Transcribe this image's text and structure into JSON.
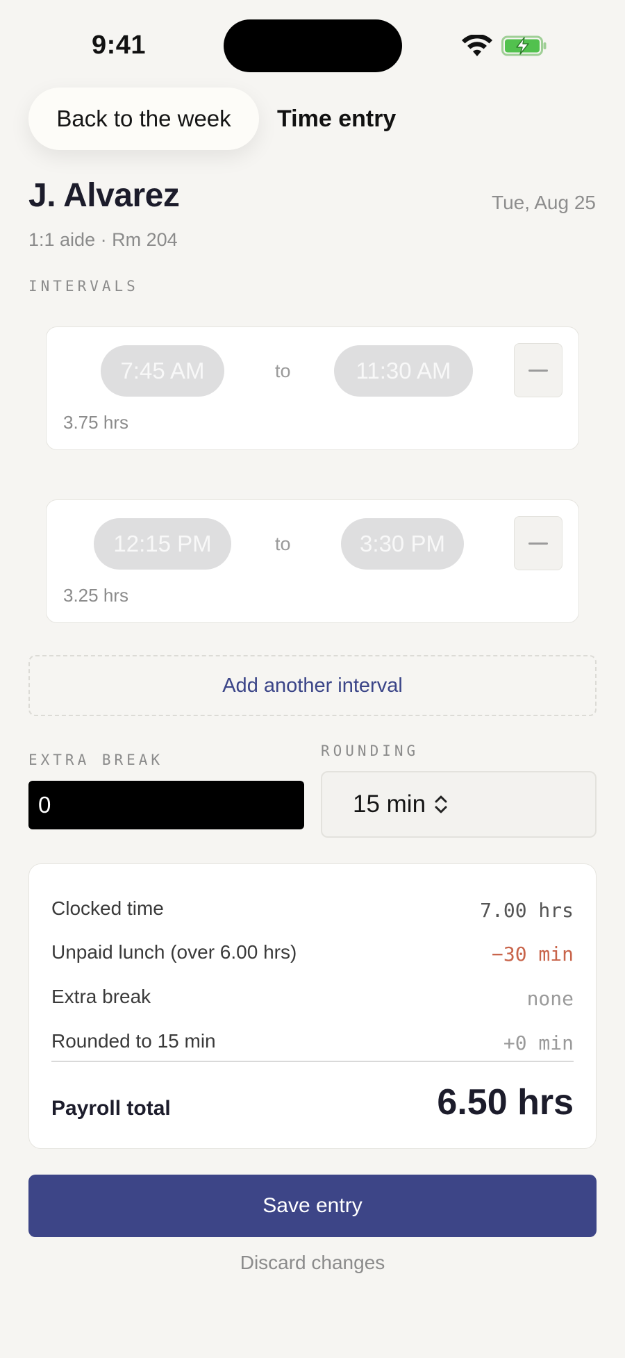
{
  "status_bar": {
    "time": "9:41"
  },
  "nav": {
    "back_label": "Back to the week",
    "title": "Time entry"
  },
  "employee": {
    "name": "J. Alvarez",
    "date": "Tue, Aug 25",
    "subtitle": "1:1 aide · Rm 204"
  },
  "intervals_label": "INTERVALS",
  "intervals": [
    {
      "start": "7:45 AM",
      "to": "to",
      "end": "11:30 AM",
      "hours": "3.75 hrs"
    },
    {
      "start": "12:15 PM",
      "to": "to",
      "end": "3:30 PM",
      "hours": "3.25 hrs"
    }
  ],
  "add_interval_label": "Add another interval",
  "extra_break": {
    "label": "EXTRA BREAK",
    "value": "0"
  },
  "rounding": {
    "label": "ROUNDING",
    "value": "15 min"
  },
  "summary": {
    "rows": [
      {
        "label": "Clocked time",
        "value": "7.00 hrs"
      },
      {
        "label": "Unpaid lunch (over 6.00 hrs)",
        "value": "−30 min"
      },
      {
        "label": "Extra break",
        "value": "none"
      },
      {
        "label": "Rounded to 15 min",
        "value": "+0 min"
      }
    ],
    "total_label": "Payroll total",
    "total_value": "6.50 hrs"
  },
  "save_label": "Save entry",
  "discard_label": "Discard changes",
  "colors": {
    "accent": "#3d4587",
    "negative": "#c8644a",
    "background": "#f6f5f2"
  }
}
